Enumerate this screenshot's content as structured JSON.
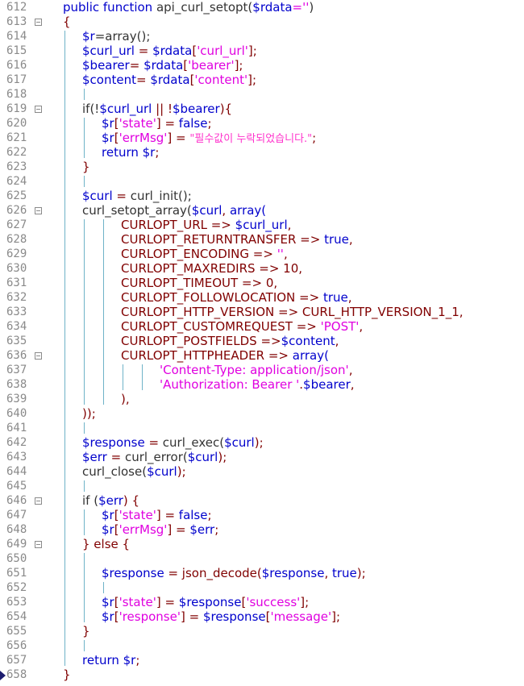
{
  "editor": {
    "lines": [
      {
        "n": "612",
        "fold": false,
        "indent": 0,
        "tokens": [
          {
            "t": "public function ",
            "c": "kw"
          },
          {
            "t": "api_curl_setopt(",
            "c": "fn"
          },
          {
            "t": "$rdata",
            "c": "var"
          },
          {
            "t": "=''",
            "c": "str"
          },
          {
            "t": ")",
            "c": "fn"
          }
        ]
      },
      {
        "n": "613",
        "fold": true,
        "indent": 0,
        "tokens": [
          {
            "t": "{",
            "c": "pn"
          }
        ]
      },
      {
        "n": "614",
        "fold": false,
        "indent": 1,
        "tokens": [
          {
            "t": "$r",
            "c": "var"
          },
          {
            "t": "=array();",
            "c": "fn"
          }
        ]
      },
      {
        "n": "615",
        "fold": false,
        "indent": 1,
        "tokens": [
          {
            "t": "$curl_url",
            "c": "var"
          },
          {
            "t": " = ",
            "c": "pn"
          },
          {
            "t": "$rdata",
            "c": "var"
          },
          {
            "t": "[",
            "c": "pn"
          },
          {
            "t": "'curl_url'",
            "c": "str"
          },
          {
            "t": "];",
            "c": "pn"
          }
        ]
      },
      {
        "n": "616",
        "fold": false,
        "indent": 1,
        "tokens": [
          {
            "t": "$bearer",
            "c": "var"
          },
          {
            "t": "= ",
            "c": "pn"
          },
          {
            "t": "$rdata",
            "c": "var"
          },
          {
            "t": "[",
            "c": "pn"
          },
          {
            "t": "'bearer'",
            "c": "str"
          },
          {
            "t": "];",
            "c": "pn"
          }
        ]
      },
      {
        "n": "617",
        "fold": false,
        "indent": 1,
        "tokens": [
          {
            "t": "$content",
            "c": "var"
          },
          {
            "t": "= ",
            "c": "pn"
          },
          {
            "t": "$rdata",
            "c": "var"
          },
          {
            "t": "[",
            "c": "pn"
          },
          {
            "t": "'content'",
            "c": "str"
          },
          {
            "t": "];",
            "c": "pn"
          }
        ]
      },
      {
        "n": "618",
        "fold": false,
        "indent": 1,
        "tokens": []
      },
      {
        "n": "619",
        "fold": true,
        "indent": 1,
        "tokens": [
          {
            "t": "if(!",
            "c": "fn"
          },
          {
            "t": "$curl_url",
            "c": "var"
          },
          {
            "t": " || !",
            "c": "pn"
          },
          {
            "t": "$bearer",
            "c": "var"
          },
          {
            "t": "){",
            "c": "pn"
          }
        ]
      },
      {
        "n": "620",
        "fold": false,
        "indent": 2,
        "tokens": [
          {
            "t": "$r",
            "c": "var"
          },
          {
            "t": "[",
            "c": "pn"
          },
          {
            "t": "'state'",
            "c": "str"
          },
          {
            "t": "] = ",
            "c": "pn"
          },
          {
            "t": "false",
            "c": "bool"
          },
          {
            "t": ";",
            "c": "pn"
          }
        ]
      },
      {
        "n": "621",
        "fold": false,
        "indent": 2,
        "tokens": [
          {
            "t": "$r",
            "c": "var"
          },
          {
            "t": "[",
            "c": "pn"
          },
          {
            "t": "'errMsg'",
            "c": "str"
          },
          {
            "t": "] = ",
            "c": "pn"
          },
          {
            "t": "\"필수값이 누락되었습니다.\"",
            "c": "kor"
          },
          {
            "t": ";",
            "c": "pn"
          }
        ]
      },
      {
        "n": "622",
        "fold": false,
        "indent": 2,
        "tokens": [
          {
            "t": "return ",
            "c": "kw"
          },
          {
            "t": "$r",
            "c": "var"
          },
          {
            "t": ";",
            "c": "pn"
          }
        ]
      },
      {
        "n": "623",
        "fold": false,
        "indent": 1,
        "tokens": [
          {
            "t": "}",
            "c": "pn"
          }
        ]
      },
      {
        "n": "624",
        "fold": false,
        "indent": 1,
        "tokens": []
      },
      {
        "n": "625",
        "fold": false,
        "indent": 1,
        "tokens": [
          {
            "t": "$curl",
            "c": "var"
          },
          {
            "t": " = ",
            "c": "pn"
          },
          {
            "t": "curl_init();",
            "c": "fn"
          }
        ]
      },
      {
        "n": "626",
        "fold": true,
        "indent": 1,
        "tokens": [
          {
            "t": "curl_setopt_array(",
            "c": "fn"
          },
          {
            "t": "$curl",
            "c": "var"
          },
          {
            "t": ", ",
            "c": "pn"
          },
          {
            "t": "array(",
            "c": "kw"
          }
        ]
      },
      {
        "n": "627",
        "fold": false,
        "indent": 3,
        "tokens": [
          {
            "t": "CURLOPT_URL => ",
            "c": "const"
          },
          {
            "t": "$curl_url",
            "c": "var"
          },
          {
            "t": ",",
            "c": "pn"
          }
        ]
      },
      {
        "n": "628",
        "fold": false,
        "indent": 3,
        "tokens": [
          {
            "t": "CURLOPT_RETURNTRANSFER => ",
            "c": "const"
          },
          {
            "t": "true",
            "c": "bool"
          },
          {
            "t": ",",
            "c": "pn"
          }
        ]
      },
      {
        "n": "629",
        "fold": false,
        "indent": 3,
        "tokens": [
          {
            "t": "CURLOPT_ENCODING => ",
            "c": "const"
          },
          {
            "t": "''",
            "c": "str"
          },
          {
            "t": ",",
            "c": "pn"
          }
        ]
      },
      {
        "n": "630",
        "fold": false,
        "indent": 3,
        "tokens": [
          {
            "t": "CURLOPT_MAXREDIRS => 10,",
            "c": "const"
          }
        ]
      },
      {
        "n": "631",
        "fold": false,
        "indent": 3,
        "tokens": [
          {
            "t": "CURLOPT_TIMEOUT => 0,",
            "c": "const"
          }
        ]
      },
      {
        "n": "632",
        "fold": false,
        "indent": 3,
        "tokens": [
          {
            "t": "CURLOPT_FOLLOWLOCATION => ",
            "c": "const"
          },
          {
            "t": "true",
            "c": "bool"
          },
          {
            "t": ",",
            "c": "pn"
          }
        ]
      },
      {
        "n": "633",
        "fold": false,
        "indent": 3,
        "tokens": [
          {
            "t": "CURLOPT_HTTP_VERSION => CURL_HTTP_VERSION_1_1,",
            "c": "const"
          }
        ]
      },
      {
        "n": "634",
        "fold": false,
        "indent": 3,
        "tokens": [
          {
            "t": "CURLOPT_CUSTOMREQUEST => ",
            "c": "const"
          },
          {
            "t": "'POST'",
            "c": "str"
          },
          {
            "t": ",",
            "c": "pn"
          }
        ]
      },
      {
        "n": "635",
        "fold": false,
        "indent": 3,
        "tokens": [
          {
            "t": "CURLOPT_POSTFIELDS =>",
            "c": "const"
          },
          {
            "t": "$content",
            "c": "var"
          },
          {
            "t": ",",
            "c": "pn"
          }
        ]
      },
      {
        "n": "636",
        "fold": true,
        "indent": 3,
        "tokens": [
          {
            "t": "CURLOPT_HTTPHEADER => ",
            "c": "const"
          },
          {
            "t": "array(",
            "c": "kw"
          }
        ]
      },
      {
        "n": "637",
        "fold": false,
        "indent": 5,
        "tokens": [
          {
            "t": "'Content-Type: application/json'",
            "c": "str"
          },
          {
            "t": ",",
            "c": "pn"
          }
        ]
      },
      {
        "n": "638",
        "fold": false,
        "indent": 5,
        "tokens": [
          {
            "t": "'Authorization: Bearer '",
            "c": "str"
          },
          {
            "t": ".",
            "c": "pn"
          },
          {
            "t": "$bearer",
            "c": "var"
          },
          {
            "t": ",",
            "c": "pn"
          }
        ]
      },
      {
        "n": "639",
        "fold": false,
        "indent": 3,
        "tokens": [
          {
            "t": "),",
            "c": "pn"
          }
        ]
      },
      {
        "n": "640",
        "fold": false,
        "indent": 1,
        "tokens": [
          {
            "t": "));",
            "c": "pn"
          }
        ]
      },
      {
        "n": "641",
        "fold": false,
        "indent": 1,
        "tokens": []
      },
      {
        "n": "642",
        "fold": false,
        "indent": 1,
        "tokens": [
          {
            "t": "$response",
            "c": "var"
          },
          {
            "t": " = ",
            "c": "pn"
          },
          {
            "t": "curl_exec(",
            "c": "fn"
          },
          {
            "t": "$curl",
            "c": "var"
          },
          {
            "t": ");",
            "c": "pn"
          }
        ]
      },
      {
        "n": "643",
        "fold": false,
        "indent": 1,
        "tokens": [
          {
            "t": "$err",
            "c": "var"
          },
          {
            "t": " = ",
            "c": "pn"
          },
          {
            "t": "curl_error(",
            "c": "fn"
          },
          {
            "t": "$curl",
            "c": "var"
          },
          {
            "t": ");",
            "c": "pn"
          }
        ]
      },
      {
        "n": "644",
        "fold": false,
        "indent": 1,
        "tokens": [
          {
            "t": "curl_close(",
            "c": "fn"
          },
          {
            "t": "$curl",
            "c": "var"
          },
          {
            "t": ");",
            "c": "pn"
          }
        ]
      },
      {
        "n": "645",
        "fold": false,
        "indent": 1,
        "tokens": []
      },
      {
        "n": "646",
        "fold": true,
        "indent": 1,
        "tokens": [
          {
            "t": "if (",
            "c": "fn"
          },
          {
            "t": "$err",
            "c": "var"
          },
          {
            "t": ") {",
            "c": "pn"
          }
        ]
      },
      {
        "n": "647",
        "fold": false,
        "indent": 2,
        "tokens": [
          {
            "t": "$r",
            "c": "var"
          },
          {
            "t": "[",
            "c": "pn"
          },
          {
            "t": "'state'",
            "c": "str"
          },
          {
            "t": "] = ",
            "c": "pn"
          },
          {
            "t": "false",
            "c": "bool"
          },
          {
            "t": ";",
            "c": "pn"
          }
        ]
      },
      {
        "n": "648",
        "fold": false,
        "indent": 2,
        "tokens": [
          {
            "t": "$r",
            "c": "var"
          },
          {
            "t": "[",
            "c": "pn"
          },
          {
            "t": "'errMsg'",
            "c": "str"
          },
          {
            "t": "] = ",
            "c": "pn"
          },
          {
            "t": "$err",
            "c": "var"
          },
          {
            "t": ";",
            "c": "pn"
          }
        ]
      },
      {
        "n": "649",
        "fold": true,
        "indent": 1,
        "tokens": [
          {
            "t": "} else {",
            "c": "pn"
          }
        ]
      },
      {
        "n": "650",
        "fold": false,
        "indent": 2,
        "tokens": []
      },
      {
        "n": "651",
        "fold": false,
        "indent": 2,
        "tokens": [
          {
            "t": "$response",
            "c": "var"
          },
          {
            "t": " = ",
            "c": "pn"
          },
          {
            "t": "json_decode(",
            "c": "const"
          },
          {
            "t": "$response",
            "c": "var"
          },
          {
            "t": ", ",
            "c": "pn"
          },
          {
            "t": "true",
            "c": "bool"
          },
          {
            "t": ");",
            "c": "pn"
          }
        ]
      },
      {
        "n": "652",
        "fold": false,
        "indent": 2,
        "tokens": []
      },
      {
        "n": "653",
        "fold": false,
        "indent": 2,
        "tokens": [
          {
            "t": "$r",
            "c": "var"
          },
          {
            "t": "[",
            "c": "pn"
          },
          {
            "t": "'state'",
            "c": "str"
          },
          {
            "t": "] = ",
            "c": "pn"
          },
          {
            "t": "$response",
            "c": "var"
          },
          {
            "t": "[",
            "c": "pn"
          },
          {
            "t": "'success'",
            "c": "str"
          },
          {
            "t": "];",
            "c": "pn"
          }
        ]
      },
      {
        "n": "654",
        "fold": false,
        "indent": 2,
        "tokens": [
          {
            "t": "$r",
            "c": "var"
          },
          {
            "t": "[",
            "c": "pn"
          },
          {
            "t": "'response'",
            "c": "str"
          },
          {
            "t": "] = ",
            "c": "pn"
          },
          {
            "t": "$response",
            "c": "var"
          },
          {
            "t": "[",
            "c": "pn"
          },
          {
            "t": "'message'",
            "c": "str"
          },
          {
            "t": "];",
            "c": "pn"
          }
        ]
      },
      {
        "n": "655",
        "fold": false,
        "indent": 1,
        "tokens": [
          {
            "t": "}",
            "c": "pn"
          }
        ]
      },
      {
        "n": "656",
        "fold": false,
        "indent": 1,
        "tokens": []
      },
      {
        "n": "657",
        "fold": false,
        "indent": 1,
        "tokens": [
          {
            "t": "return ",
            "c": "kw"
          },
          {
            "t": "$r",
            "c": "var"
          },
          {
            "t": ";",
            "c": "pn"
          }
        ]
      },
      {
        "n": "658",
        "fold": false,
        "indent": 0,
        "tokens": [
          {
            "t": "}",
            "c": "pn"
          }
        ]
      }
    ]
  },
  "colors": {
    "keyword": "#0000cc",
    "string": "#e000e0",
    "punct": "#800000",
    "line_number": "#8a8a8a",
    "indent_guide": "#6fb3c8"
  },
  "icons": {
    "current_line_marker": "breakpoint-arrow-icon",
    "fold_toggle": "fold-minus-icon"
  }
}
